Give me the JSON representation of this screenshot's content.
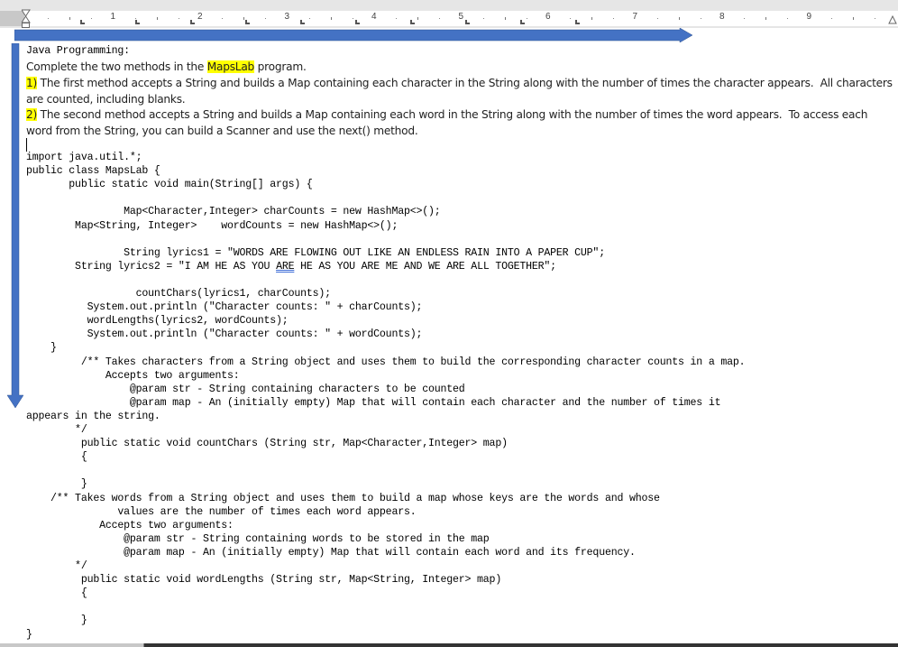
{
  "ruler": {
    "numbers": [
      "1",
      "2",
      "3",
      "4",
      "5",
      "6",
      "7",
      "8",
      "9"
    ]
  },
  "icons": {
    "indent_marker": "hourglass-indent-icon",
    "right_indent": "triangle-right-indent-icon",
    "arrow_right": "blue-arrow-right-icon",
    "arrow_down": "blue-arrow-down-icon"
  },
  "colors": {
    "arrow": "#4472c4",
    "highlight": "#ffff00"
  },
  "document": {
    "heading": "Java Programming:",
    "intro_before": "Complete the two methods in the ",
    "intro_highlight": "MapsLab",
    "intro_after": " program.",
    "item1_num": "1)",
    "item1_line1": " The first method accepts a String and builds a Map containing each character in the String along with the number of times the character appears.  All characters",
    "item1_line2": "are counted, including blanks.",
    "item2_num": "2)",
    "item2_line1": " The second method accepts a String and builds a Map containing each word in the String along with the number of times the word appears.  To access each",
    "item2_line2": "word from the String, you can build a Scanner and use the next() method.",
    "code": {
      "l01": "import java.util.*;",
      "l02": "public class MapsLab {",
      "l03": "       public static void main(String[] args) {",
      "l04": "                Map<Character,Integer> charCounts = new HashMap<>();",
      "l05": "        Map<String, Integer>    wordCounts = new HashMap<>();",
      "l06": "                String lyrics1 = \"WORDS ARE FLOWING OUT LIKE AN ENDLESS RAIN INTO A PAPER CUP\";",
      "l07a": "        String lyrics2 = \"I AM HE AS YOU ",
      "l07b": "ARE",
      "l07c": " HE AS YOU ARE ME AND WE ARE ALL TOGETHER\";",
      "l08": "                  countChars(lyrics1, charCounts);",
      "l09": "          System.out.println (\"Character counts: \" + charCounts);",
      "l10": "          wordLengths(lyrics2, wordCounts);",
      "l11": "          System.out.println (\"Character counts: \" + wordCounts);",
      "l12": "    }",
      "l13": "         /** Takes characters from a String object and uses them to build the corresponding character counts in a map.",
      "l14": "             Accepts two arguments:",
      "l15": "                 @param str - String containing characters to be counted",
      "l16": "                 @param map - An (initially empty) Map that will contain each character and the number of times it",
      "l17": "appears in the string.",
      "l18": "        */",
      "l19": "         public static void countChars (String str, Map<Character,Integer> map)",
      "l20": "         {",
      "l21": "         }",
      "l22": "    /** Takes words from a String object and uses them to build a map whose keys are the words and whose",
      "l23": "               values are the number of times each word appears.",
      "l24": "            Accepts two arguments:",
      "l25": "                @param str - String containing words to be stored in the map",
      "l26": "                @param map - An (initially empty) Map that will contain each word and its frequency.",
      "l27": "        */",
      "l28": "         public static void wordLengths (String str, Map<String, Integer> map)",
      "l29": "         {",
      "l30": "         }",
      "l31": "}"
    }
  }
}
